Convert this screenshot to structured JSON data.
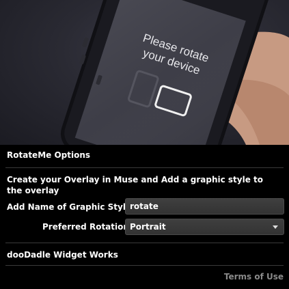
{
  "hero": {
    "screen_text_line1": "Please rotate",
    "screen_text_line2": "your device"
  },
  "panel": {
    "title": "RotateMe Options",
    "description": "Create your Overlay in Muse and Add a graphic style to the overlay",
    "graphic_style_label": "Add Name of Graphic Style",
    "graphic_style_value": "rotate",
    "rotation_label": "Preferred Rotation",
    "rotation_value": "Portrait",
    "brand": "dooDadle Widget Works",
    "terms_link": "Terms of Use"
  }
}
